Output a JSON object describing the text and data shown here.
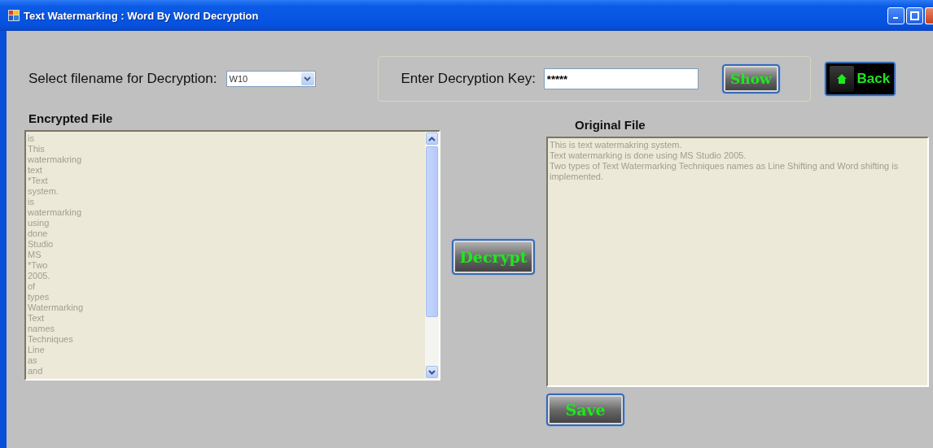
{
  "window": {
    "title": "Text Watermarking : Word By Word Decryption"
  },
  "file_select": {
    "label": "Select filename for Decryption:",
    "value": "W10"
  },
  "key": {
    "label": "Enter Decryption Key:",
    "value": "*****"
  },
  "buttons": {
    "show": "Show",
    "back": "Back",
    "decrypt": "Decrypt",
    "save": "Save"
  },
  "encrypted": {
    "heading": "Encrypted File",
    "lines": [
      "is",
      "This",
      "watermakring",
      "text",
      "*Text",
      "system.",
      "is",
      "watermarking",
      "using",
      "done",
      "Studio",
      "MS",
      "*Two",
      "2005.",
      "of",
      "types",
      "Watermarking",
      "Text",
      "names",
      "Techniques",
      "Line",
      "as",
      "and"
    ]
  },
  "original": {
    "heading": "Original File",
    "lines": [
      "This is text watermakring system.",
      "Text watermarking is done using MS Studio 2005.",
      "Two types of Text Watermarking Techniques names as Line Shifting and Word shifting is implemented."
    ]
  }
}
